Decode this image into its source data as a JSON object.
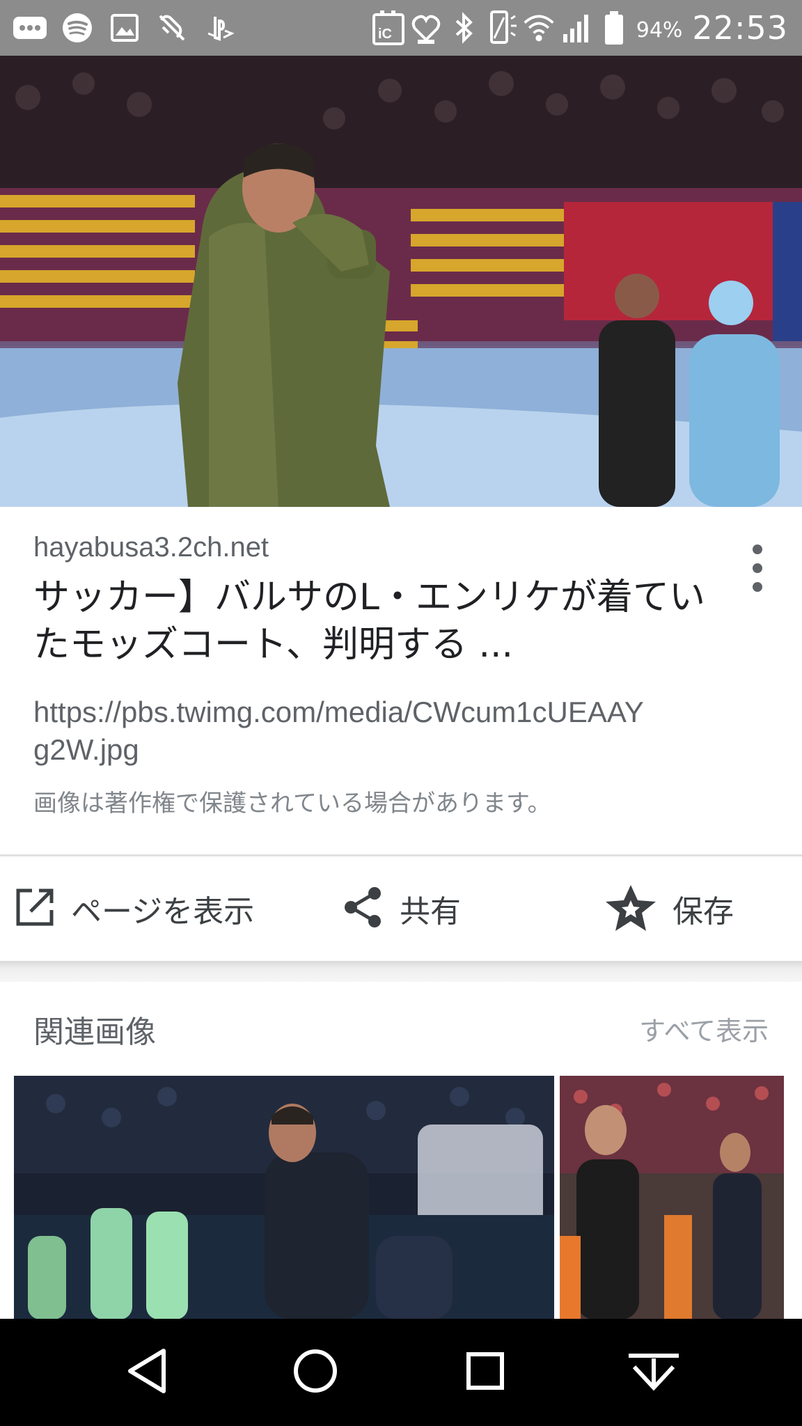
{
  "status_bar": {
    "left_icons": [
      "message-icon",
      "spotify-icon",
      "image-icon",
      "vibration-off-icon",
      "playstation-icon"
    ],
    "right_icons": [
      "nfc-icon",
      "heart-monitor-icon",
      "bluetooth-icon",
      "vibrate-icon",
      "wifi-icon",
      "signal-icon",
      "battery-icon"
    ],
    "battery_percent": "94%",
    "time": "22:53"
  },
  "result": {
    "domain": "hayabusa3.2ch.net",
    "title": "サッカー】バルサのL・エンリケが着ていたモッズコート、判明する ...",
    "image_url": "https://pbs.twimg.com/media/CWcum1cUEAAYg2W.jpg",
    "copyright_notice": "画像は著作権で保護されている場合があります。"
  },
  "actions": {
    "visit_label": "ページを表示",
    "share_label": "共有",
    "save_label": "保存"
  },
  "related": {
    "title": "関連画像",
    "see_all_label": "すべて表示"
  },
  "colors": {
    "status_bar": "#8c8c8c",
    "nav_bar": "#000000",
    "text_primary": "#202124",
    "text_secondary": "#5f6368"
  }
}
